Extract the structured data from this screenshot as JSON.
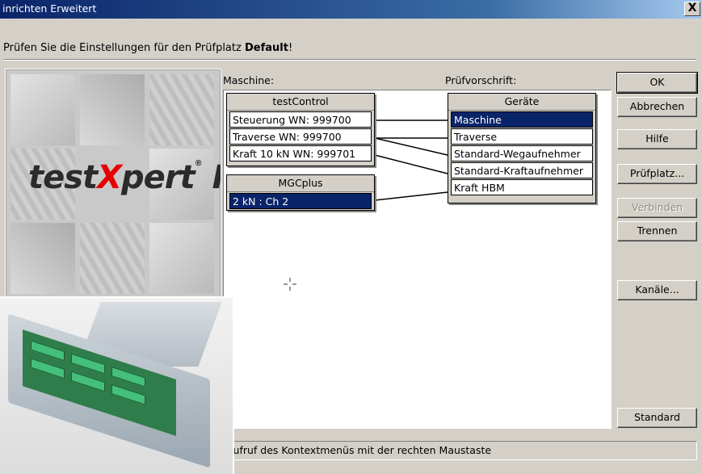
{
  "window": {
    "title": "inrichten Erweitert",
    "close_label": "X"
  },
  "prompt": {
    "prefix": "Prüfen Sie die Einstellungen für den Prüfplatz ",
    "name": "Default",
    "suffix": "!"
  },
  "logo": {
    "text_pre": "test",
    "text_x": "X",
    "text_post": "pert",
    "reg": "®",
    "roman": "II"
  },
  "labels": {
    "machine": "Maschine:",
    "spec": "Prüfvorschrift:"
  },
  "devices": [
    {
      "title": "testControl",
      "channels": [
        "Steuerung WN: 999700",
        "Traverse WN: 999700",
        "Kraft 10 kN WN: 999701"
      ]
    },
    {
      "title": "MGCplus",
      "channels": [
        "2 kN : Ch 2"
      ],
      "selected": 0
    }
  ],
  "spec": {
    "title": "Geräte",
    "items": [
      "Maschine",
      "Traverse",
      "Standard-Wegaufnehmer",
      "Standard-Kraftaufnehmer",
      "Kraft HBM"
    ],
    "selected": 0
  },
  "buttons": {
    "ok": "OK",
    "cancel": "Abbrechen",
    "help": "Hilfe",
    "station": "Prüfplatz...",
    "connect": "Verbinden",
    "disconnect": "Trennen",
    "channels": "Kanäle...",
    "standard": "Standard"
  },
  "status": "Aufruf des Kontextmenüs mit der rechten Maustaste",
  "colors": {
    "selection": "#0a246a",
    "dialog": "#d4d0c8",
    "logo_x": "#e60000"
  }
}
